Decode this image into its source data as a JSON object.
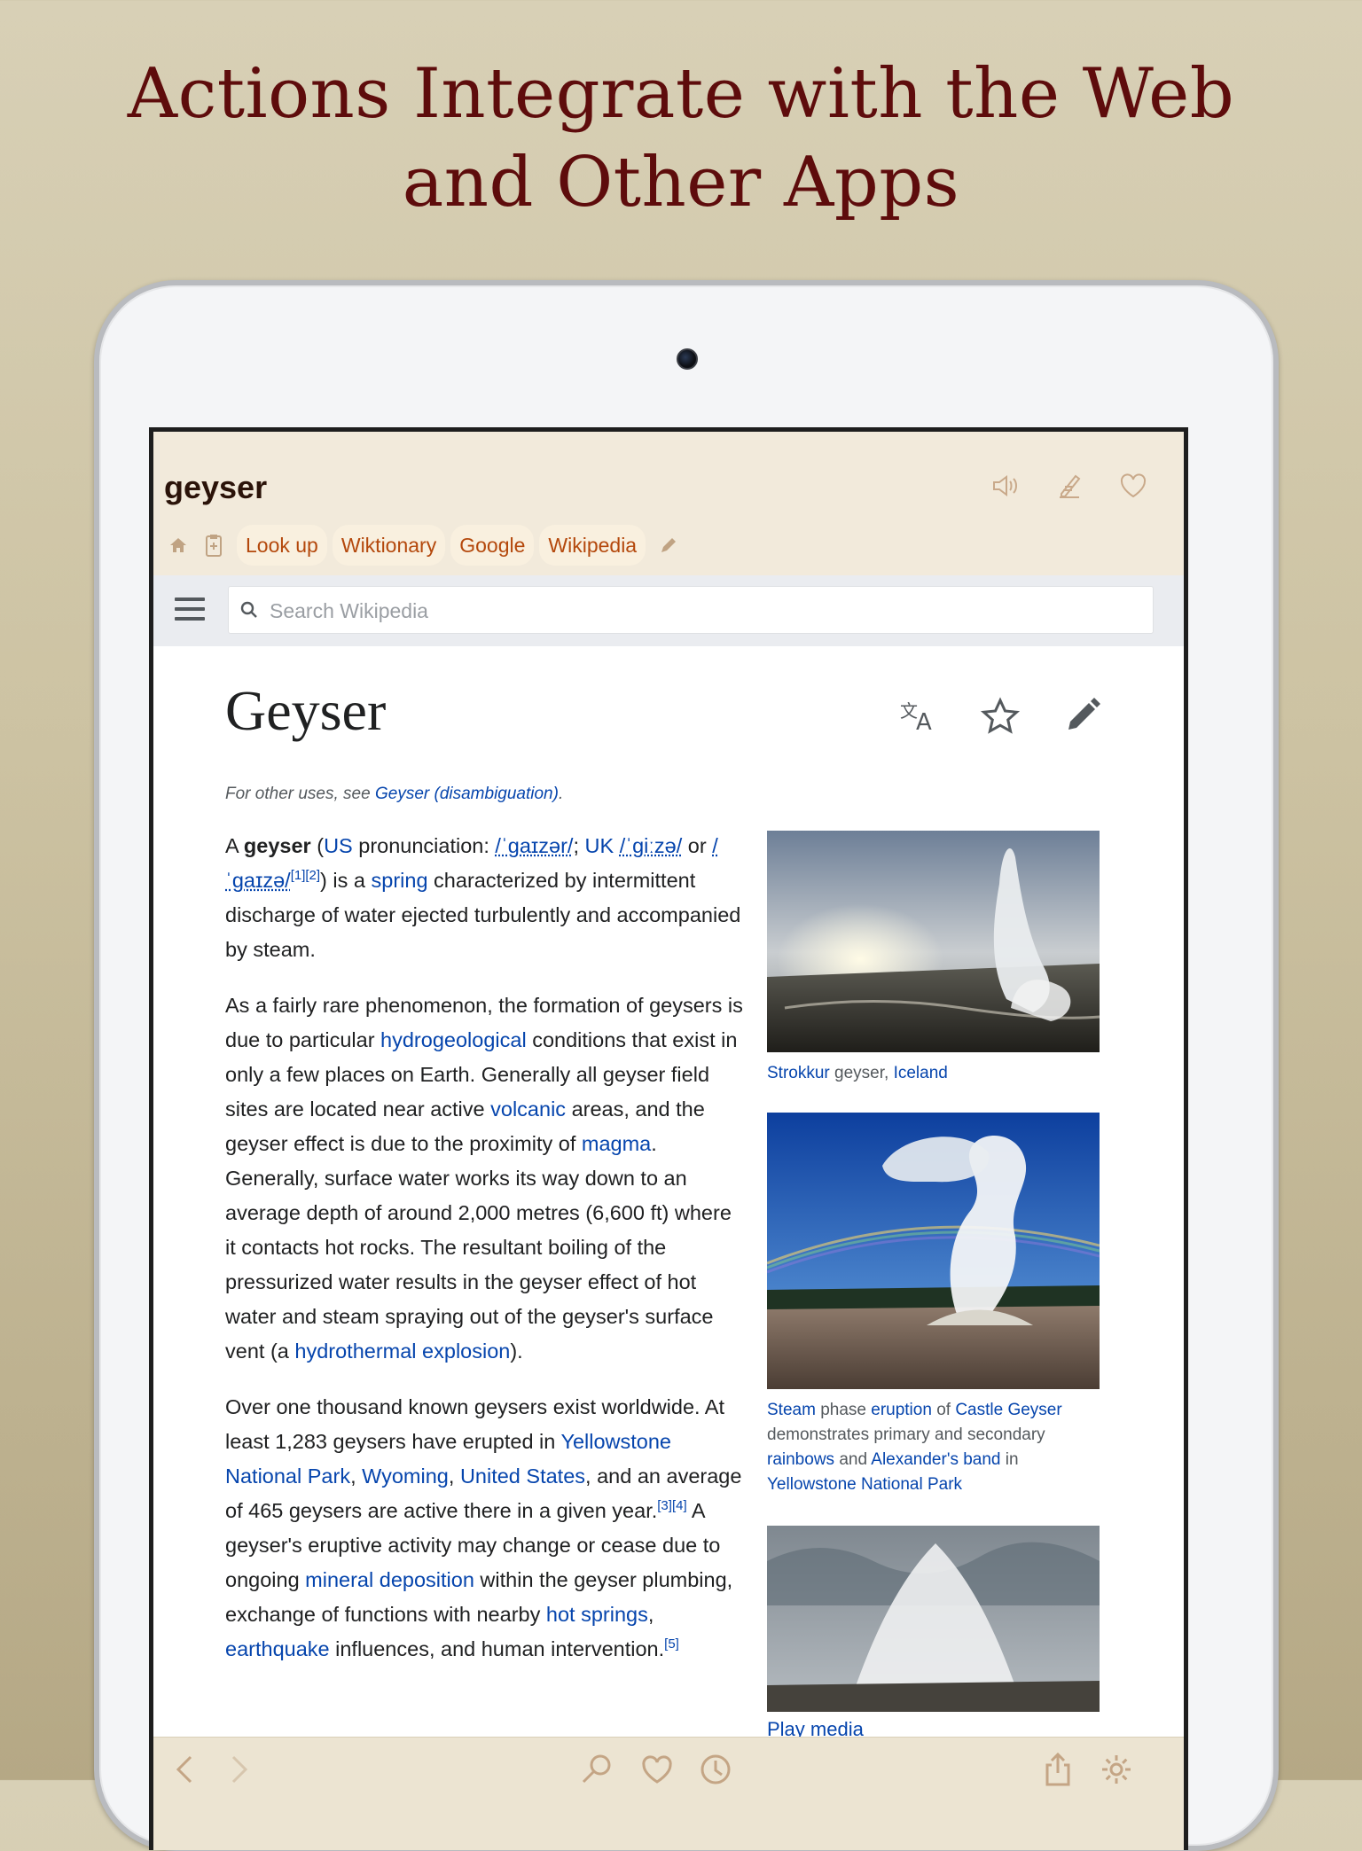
{
  "headline": {
    "line1": "Actions Integrate with the Web",
    "line2": "and Other Apps"
  },
  "appbar": {
    "word": "geyser",
    "icons": [
      "speaker-icon",
      "notes-icon",
      "heart-icon"
    ],
    "tool_icons": [
      "home-icon",
      "clipboard-add-icon",
      "pencil-icon"
    ],
    "actions": [
      "Look up",
      "Wiktionary",
      "Google",
      "Wikipedia"
    ]
  },
  "wiki_header": {
    "search_placeholder": "Search Wikipedia"
  },
  "article": {
    "title": "Geyser",
    "header_icons": [
      "translate-icon",
      "star-icon",
      "edit-pencil-icon"
    ],
    "hatnote_prefix": "For other uses, see ",
    "hatnote_link": "Geyser (disambiguation)",
    "hatnote_suffix": ".",
    "p1": {
      "t1": "A ",
      "bold": "geyser",
      "t2": " (",
      "l_us": "US",
      "t3": " pronunciation: ",
      "ipa1": "/ˈɡaɪzər/",
      "t4": "; ",
      "l_uk": "UK",
      "t5": " ",
      "ipa2": "/ˈɡiːzə/",
      "t6": " or ",
      "ipa3": "/ˈɡaɪzə/",
      "sup": "[1][2]",
      "t7": ") is a ",
      "l_spring": "spring",
      "t8": " characterized by intermittent discharge of water ejected turbulently and accompanied by steam."
    },
    "p2": {
      "t1": "As a fairly rare phenomenon, the formation of geysers is due to particular ",
      "l1": "hydrogeological",
      "t2": " conditions that exist in only a few places on Earth. Generally all geyser field sites are located near active ",
      "l2": "volcanic",
      "t3": " areas, and the geyser effect is due to the proximity of ",
      "l3": "magma",
      "t4": ". Generally, surface water works its way down to an average depth of around 2,000 metres (6,600 ft) where it contacts hot rocks. The resultant boiling of the pressurized water results in the geyser effect of hot water and steam spraying out of the geyser's surface vent (a ",
      "l4": "hydrothermal explosion",
      "t5": ")."
    },
    "p3": {
      "t1": "Over one thousand known geysers exist worldwide. At least 1,283 geysers have erupted in ",
      "l1": "Yellowstone National Park",
      "t2": ", ",
      "l2": "Wyoming",
      "t3": ", ",
      "l3": "United States",
      "t4": ", and an average of 465 geysers are active there in a given year.",
      "sup1": "[3][4]",
      "t5": " A geyser's eruptive activity may change or cease due to ongoing ",
      "l4": "mineral deposition",
      "t6": " within the geyser plumbing, exchange of functions with nearby ",
      "l5": "hot springs",
      "t7": ", ",
      "l6": "earthquake",
      "t8": " influences, and human intervention.",
      "sup2": "[5]"
    },
    "figures": {
      "f1": {
        "l1": "Strokkur",
        "t1": " geyser, ",
        "l2": "Iceland"
      },
      "f2": {
        "l1": "Steam",
        "t1": " phase ",
        "l2": "eruption",
        "t2": " of ",
        "l3": "Castle Geyser",
        "t3": " demonstrates primary and secondary ",
        "l4": "rainbows",
        "t4": " and ",
        "l5": "Alexander's band",
        "t5": " in ",
        "l6": "Yellowstone National Park"
      },
      "f3": {
        "l1": "Play media"
      }
    }
  },
  "bottombar": {
    "icons": [
      "back-icon",
      "forward-icon",
      "search-icon",
      "favorites-icon",
      "history-icon",
      "share-icon",
      "settings-icon"
    ]
  }
}
